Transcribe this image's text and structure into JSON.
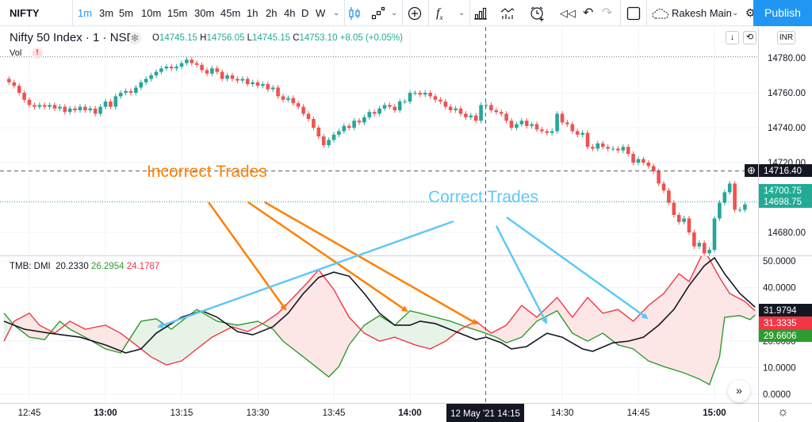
{
  "toolbar": {
    "symbol": "NIFTY",
    "intervals": [
      "1m",
      "3m",
      "5m",
      "10m",
      "15m",
      "30m",
      "45m",
      "1h",
      "2h",
      "4h",
      "D",
      "W"
    ],
    "selected_interval": "1m",
    "layout_name": "Rakesh Main",
    "publish_label": "Publish",
    "icons": [
      "chevron-down-icon",
      "candles-icon",
      "compare-icon",
      "add-symbol-icon",
      "fx-icon",
      "bar-chart-icon",
      "indicators-icon",
      "alert-icon",
      "replay-icon",
      "undo-icon",
      "redo-icon",
      "rectangle-icon",
      "cloud-icon",
      "gear-icon"
    ]
  },
  "legend": {
    "title": "Nifty 50 Index · 1 · NSE",
    "o_label": "O",
    "o": "14745.15",
    "h_label": "H",
    "h": "14756.05",
    "l_label": "L",
    "l": "14745.15",
    "c_label": "C",
    "c": "14753.10",
    "change": "+8.05 (+0.05%)",
    "vol": "Vol",
    "warning": "!",
    "currency": "INR"
  },
  "dmi_legend": {
    "name": "TMB: DMI",
    "adx": "20.2330",
    "plus_di": "26.2954",
    "minus_di": "24.1787"
  },
  "annotations": {
    "incorrect": "Incorrect Trades",
    "correct": "Correct Trades"
  },
  "colors": {
    "up": "#26a69a",
    "down": "#ef5350",
    "adx": "#131722",
    "plus_di": "#2e9b2e",
    "minus_di": "#f23645",
    "incorrect": "#ff8000",
    "correct": "#5ec8fa",
    "accent": "#2196f3"
  },
  "price_axis": {
    "ticks": [
      "14780.00",
      "14760.00",
      "14740.00",
      "14720.00",
      "14680.00"
    ],
    "crosshair_label": "14716.40",
    "labels": [
      "14700.75",
      "14698.75"
    ]
  },
  "dmi_axis": {
    "ticks": [
      "50.0000",
      "40.0000",
      "20.0000",
      "10.0000",
      "0.0000"
    ],
    "labels": {
      "adx": "31.9794",
      "minus_di": "31.3335",
      "plus_di": "29.6606"
    }
  },
  "time_axis": {
    "ticks": [
      "12:45",
      "13:00",
      "13:15",
      "13:30",
      "13:45",
      "14:00",
      "14:30",
      "14:45",
      "15:00"
    ],
    "crosshair_label": "12 May '21   14:15"
  },
  "chart_data": [
    {
      "type": "candlestick",
      "title": "Nifty 50 Index · 1 · NSE",
      "start_time": "12:41",
      "interval_minutes": 1,
      "ylim": [
        14660,
        14790
      ],
      "crosshair": {
        "time": "14:15",
        "price": 14716.4
      },
      "closes": [
        14766,
        14764,
        14760,
        14756,
        14753,
        14752,
        14753,
        14752,
        14753,
        14751,
        14752,
        14749,
        14751,
        14750,
        14752,
        14750,
        14751,
        14748,
        14752,
        14755,
        14752,
        14758,
        14760,
        14761,
        14760,
        14763,
        14766,
        14768,
        14770,
        14772,
        14774,
        14775,
        14774,
        14775,
        14777,
        14779,
        14777,
        14776,
        14773,
        14771,
        14774,
        14772,
        14768,
        14770,
        14768,
        14767,
        14768,
        14765,
        14766,
        14764,
        14765,
        14762,
        14763,
        14758,
        14756,
        14757,
        14754,
        14752,
        14748,
        14745,
        14740,
        14735,
        14730,
        14733,
        14736,
        14738,
        14741,
        14740,
        14744,
        14743,
        14746,
        14749,
        14748,
        14751,
        14753,
        14752,
        14750,
        14755,
        14755,
        14760,
        14760,
        14759,
        14760,
        14758,
        14756,
        14755,
        14752,
        14750,
        14751,
        14748,
        14746,
        14747,
        14744,
        14753,
        14753,
        14750,
        14749,
        14748,
        14744,
        14740,
        14742,
        14744,
        14741,
        14742,
        14739,
        14738,
        14737,
        14738,
        14748,
        14743,
        14742,
        14738,
        14736,
        14737,
        14729,
        14728,
        14731,
        14729,
        14728,
        14728,
        14727,
        14729,
        14725,
        14720,
        14722,
        14720,
        14718,
        14715,
        14708,
        14704,
        14697,
        14690,
        14686,
        14688,
        14680,
        14672,
        14674,
        14668,
        14670,
        14688,
        14697,
        14703,
        14708,
        14693,
        14693,
        14696
      ]
    },
    {
      "type": "line",
      "title": "TMB: DMI",
      "ylim": [
        0,
        55
      ],
      "series": [
        {
          "key": "adx",
          "points": [
            [
              "12:40",
              27.4
            ],
            [
              "12:44",
              24.4
            ],
            [
              "12:49",
              22.9
            ],
            [
              "12:55",
              21.4
            ],
            [
              "13:00",
              18.5
            ],
            [
              "13:04",
              15.5
            ],
            [
              "13:07",
              17
            ],
            [
              "13:10",
              22.9
            ],
            [
              "13:15",
              28.9
            ],
            [
              "13:19",
              31.3
            ],
            [
              "13:22",
              28.9
            ],
            [
              "13:26",
              23.5
            ],
            [
              "13:29",
              22.3
            ],
            [
              "13:33",
              25.3
            ],
            [
              "13:36",
              30.4
            ],
            [
              "13:39",
              37.8
            ],
            [
              "13:42",
              43.8
            ],
            [
              "13:45",
              45.8
            ],
            [
              "13:48",
              44.3
            ],
            [
              "13:51",
              37.8
            ],
            [
              "13:54",
              30.4
            ],
            [
              "13:57",
              25.9
            ],
            [
              "14:00",
              25.9
            ],
            [
              "14:02",
              27.4
            ],
            [
              "14:05",
              26.5
            ],
            [
              "14:09",
              23.5
            ],
            [
              "14:13",
              20.5
            ],
            [
              "14:15",
              21.4
            ],
            [
              "14:18",
              19.3
            ],
            [
              "14:20",
              17
            ],
            [
              "14:23",
              17.9
            ],
            [
              "14:27",
              22.9
            ],
            [
              "14:30",
              21.4
            ],
            [
              "14:34",
              17
            ],
            [
              "14:36",
              16.1
            ],
            [
              "14:40",
              19.3
            ],
            [
              "14:43",
              19.9
            ],
            [
              "14:46",
              21.4
            ],
            [
              "14:49",
              25.9
            ],
            [
              "14:52",
              31.8
            ],
            [
              "14:55",
              40.8
            ],
            [
              "14:58",
              48.2
            ],
            [
              "15:00",
              51.2
            ],
            [
              "15:02",
              45.2
            ],
            [
              "15:05",
              37.8
            ],
            [
              "15:08",
              32.7
            ]
          ]
        },
        {
          "key": "plus_di",
          "points": [
            [
              "12:40",
              30.4
            ],
            [
              "12:42",
              25.9
            ],
            [
              "12:45",
              21.4
            ],
            [
              "12:48",
              20.5
            ],
            [
              "12:51",
              27.4
            ],
            [
              "12:53",
              24.4
            ],
            [
              "12:56",
              21.4
            ],
            [
              "13:00",
              17
            ],
            [
              "13:03",
              15.5
            ],
            [
              "13:07",
              27.4
            ],
            [
              "13:10",
              28.3
            ],
            [
              "13:13",
              24.4
            ],
            [
              "13:16",
              28.9
            ],
            [
              "13:18",
              31.8
            ],
            [
              "13:22",
              27.4
            ],
            [
              "13:26",
              25.9
            ],
            [
              "13:30",
              27.4
            ],
            [
              "13:33",
              24.4
            ],
            [
              "13:35",
              19.9
            ],
            [
              "13:39",
              14
            ],
            [
              "13:42",
              9.5
            ],
            [
              "13:44",
              6.5
            ],
            [
              "13:46",
              10.4
            ],
            [
              "13:48",
              18.5
            ],
            [
              "13:51",
              25.9
            ],
            [
              "13:54",
              29.5
            ],
            [
              "13:57",
              25.9
            ],
            [
              "14:00",
              31.3
            ],
            [
              "14:02",
              30.4
            ],
            [
              "14:05",
              28.9
            ],
            [
              "14:08",
              27.4
            ],
            [
              "14:11",
              25.3
            ],
            [
              "14:14",
              23.5
            ],
            [
              "14:17",
              21.4
            ],
            [
              "14:19",
              19.3
            ],
            [
              "14:22",
              21.4
            ],
            [
              "14:25",
              27.4
            ],
            [
              "14:29",
              31.3
            ],
            [
              "14:32",
              22.9
            ],
            [
              "14:35",
              19.9
            ],
            [
              "14:38",
              22.9
            ],
            [
              "14:41",
              18.5
            ],
            [
              "14:44",
              17
            ],
            [
              "14:47",
              12.5
            ],
            [
              "14:50",
              10.4
            ],
            [
              "14:54",
              8
            ],
            [
              "14:57",
              5.7
            ],
            [
              "14:59",
              3.6
            ],
            [
              "15:01",
              14
            ],
            [
              "15:02",
              28.9
            ],
            [
              "15:05",
              29.5
            ],
            [
              "15:07",
              28
            ],
            [
              "15:08",
              29.7
            ]
          ]
        },
        {
          "key": "minus_di",
          "points": [
            [
              "12:40",
              19.9
            ],
            [
              "12:42",
              27.4
            ],
            [
              "12:45",
              30.4
            ],
            [
              "12:47",
              25.9
            ],
            [
              "12:50",
              22.9
            ],
            [
              "12:53",
              27.4
            ],
            [
              "12:56",
              24.4
            ],
            [
              "13:00",
              25.9
            ],
            [
              "13:03",
              22.9
            ],
            [
              "13:06",
              18.5
            ],
            [
              "13:09",
              14
            ],
            [
              "13:12",
              11
            ],
            [
              "13:15",
              12.5
            ],
            [
              "13:18",
              17
            ],
            [
              "13:21",
              21.4
            ],
            [
              "13:25",
              25.3
            ],
            [
              "13:28",
              23.5
            ],
            [
              "13:31",
              26.5
            ],
            [
              "13:34",
              30.4
            ],
            [
              "13:37",
              36.3
            ],
            [
              "13:40",
              42.3
            ],
            [
              "13:42",
              46.7
            ],
            [
              "13:45",
              39.3
            ],
            [
              "13:48",
              28.9
            ],
            [
              "13:51",
              22.9
            ],
            [
              "13:54",
              19.9
            ],
            [
              "13:57",
              21.4
            ],
            [
              "14:01",
              18.5
            ],
            [
              "14:04",
              17
            ],
            [
              "14:07",
              19.9
            ],
            [
              "14:10",
              24.4
            ],
            [
              "14:13",
              27.4
            ],
            [
              "14:16",
              22.9
            ],
            [
              "14:19",
              25.9
            ],
            [
              "14:22",
              33.3
            ],
            [
              "14:25",
              28.9
            ],
            [
              "14:29",
              36.3
            ],
            [
              "14:32",
              28.9
            ],
            [
              "14:35",
              36.3
            ],
            [
              "14:38",
              30.4
            ],
            [
              "14:41",
              31.8
            ],
            [
              "14:44",
              27.4
            ],
            [
              "14:47",
              33.3
            ],
            [
              "14:50",
              37.8
            ],
            [
              "14:53",
              45.2
            ],
            [
              "14:55",
              42.3
            ],
            [
              "14:58",
              54.2
            ],
            [
              "15:01",
              43.8
            ],
            [
              "15:03",
              37.8
            ],
            [
              "15:06",
              34.8
            ],
            [
              "15:08",
              31.3
            ]
          ]
        }
      ]
    }
  ]
}
